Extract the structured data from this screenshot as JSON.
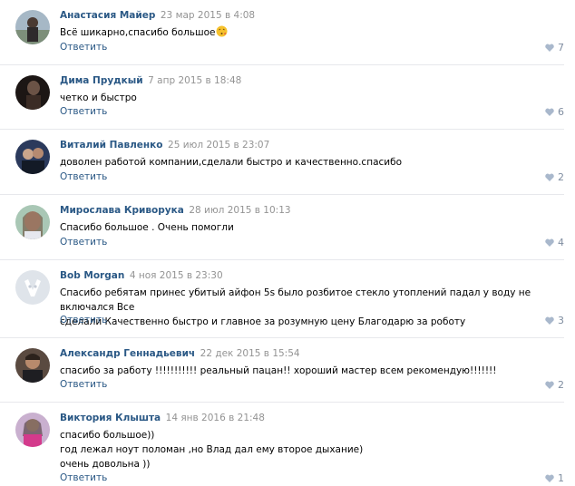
{
  "reply_label": "Ответить",
  "colors": {
    "author": "#2a5885",
    "date": "#939393",
    "divider": "#e7e8ec",
    "like": "#a9b8cc"
  },
  "comments": [
    {
      "author": "Анастасия Майер",
      "date": "23 мар 2015 в 4:08",
      "text": "Всё шикарно,спасибо большое",
      "likes": "7",
      "emoji": "kissing-face-icon"
    },
    {
      "author": "Дима Прудкый",
      "date": "7 апр 2015 в 18:48",
      "text": "четко и быстро",
      "likes": "6"
    },
    {
      "author": "Виталий Павленко",
      "date": "25 июл 2015 в 23:07",
      "text": "доволен работой компании,сделали быстро и качественно.спасибо",
      "likes": "2"
    },
    {
      "author": "Мирослава Криворука",
      "date": "28 июл 2015 в 10:13",
      "text": "Спасибо большое . Очень помогли",
      "likes": "4"
    },
    {
      "author": "Bob Morgan",
      "date": "4 ноя 2015 в 23:30",
      "text": "Спасибо ребятам принес убитый айфон 5s было розбитое стекло утоплений падал у воду не включался Все\nсделали Качественно быстро и главное за розумную цену Благодарю за роботу",
      "likes": "3"
    },
    {
      "author": "Александр Геннадьевич",
      "date": "22 дек 2015 в 15:54",
      "text": "спасибо за работу !!!!!!!!!!! реальный пацан!! хороший мастер всем рекомендую!!!!!!!",
      "likes": "2"
    },
    {
      "author": "Виктория Клышта",
      "date": "14 янв 2016 в 21:48",
      "text": "спасибо большое))\nгод лежал ноут поломан ,но Влад дал ему второе дыхание)\nочень довольна ))",
      "likes": "1"
    }
  ]
}
